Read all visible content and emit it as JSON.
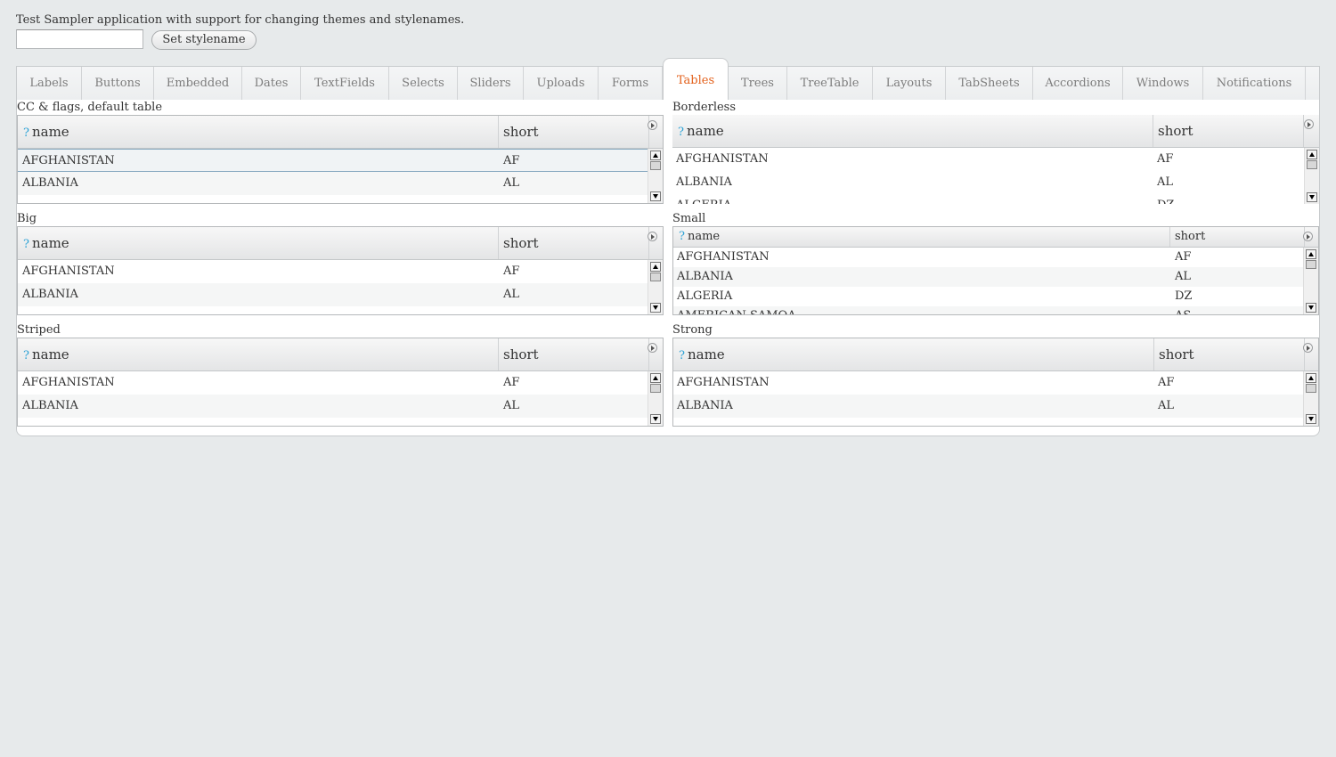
{
  "intro": {
    "text": "Test Sampler application with support for changing themes and stylenames."
  },
  "stylename": {
    "value": "",
    "placeholder": "",
    "button_label": "Set stylename"
  },
  "tabs": [
    {
      "label": "Labels"
    },
    {
      "label": "Buttons"
    },
    {
      "label": "Embedded"
    },
    {
      "label": "Dates"
    },
    {
      "label": "TextFields"
    },
    {
      "label": "Selects"
    },
    {
      "label": "Sliders"
    },
    {
      "label": "Uploads"
    },
    {
      "label": "Forms"
    },
    {
      "label": "Tables"
    },
    {
      "label": "Trees"
    },
    {
      "label": "TreeTable"
    },
    {
      "label": "Layouts"
    },
    {
      "label": "TabSheets"
    },
    {
      "label": "Accordions"
    },
    {
      "label": "Windows"
    },
    {
      "label": "Notifications"
    }
  ],
  "active_tab": "Tables",
  "columns": {
    "name": "name",
    "short": "short",
    "help_icon": "?"
  },
  "tables": [
    {
      "caption": "CC & flags, default table",
      "rows": [
        {
          "name": "AFGHANISTAN",
          "short": "AF"
        },
        {
          "name": "ALBANIA",
          "short": "AL"
        }
      ]
    },
    {
      "caption": "Borderless",
      "rows": [
        {
          "name": "AFGHANISTAN",
          "short": "AF"
        },
        {
          "name": "ALBANIA",
          "short": "AL"
        },
        {
          "name": "ALGERIA",
          "short": "DZ"
        }
      ]
    },
    {
      "caption": "Big",
      "rows": [
        {
          "name": "AFGHANISTAN",
          "short": "AF"
        },
        {
          "name": "ALBANIA",
          "short": "AL"
        }
      ]
    },
    {
      "caption": "Small",
      "rows": [
        {
          "name": "AFGHANISTAN",
          "short": "AF"
        },
        {
          "name": "ALBANIA",
          "short": "AL"
        },
        {
          "name": "ALGERIA",
          "short": "DZ"
        },
        {
          "name": "AMERICAN SAMOA",
          "short": "AS"
        }
      ]
    },
    {
      "caption": "Striped",
      "rows": [
        {
          "name": "AFGHANISTAN",
          "short": "AF"
        },
        {
          "name": "ALBANIA",
          "short": "AL"
        }
      ]
    },
    {
      "caption": "Strong",
      "rows": [
        {
          "name": "AFGHANISTAN",
          "short": "AF"
        },
        {
          "name": "ALBANIA",
          "short": "AL"
        }
      ]
    }
  ],
  "colors": {
    "active_tab": "#e3611c",
    "help_icon": "#2ea3d6",
    "background": "#e7eaeb"
  }
}
